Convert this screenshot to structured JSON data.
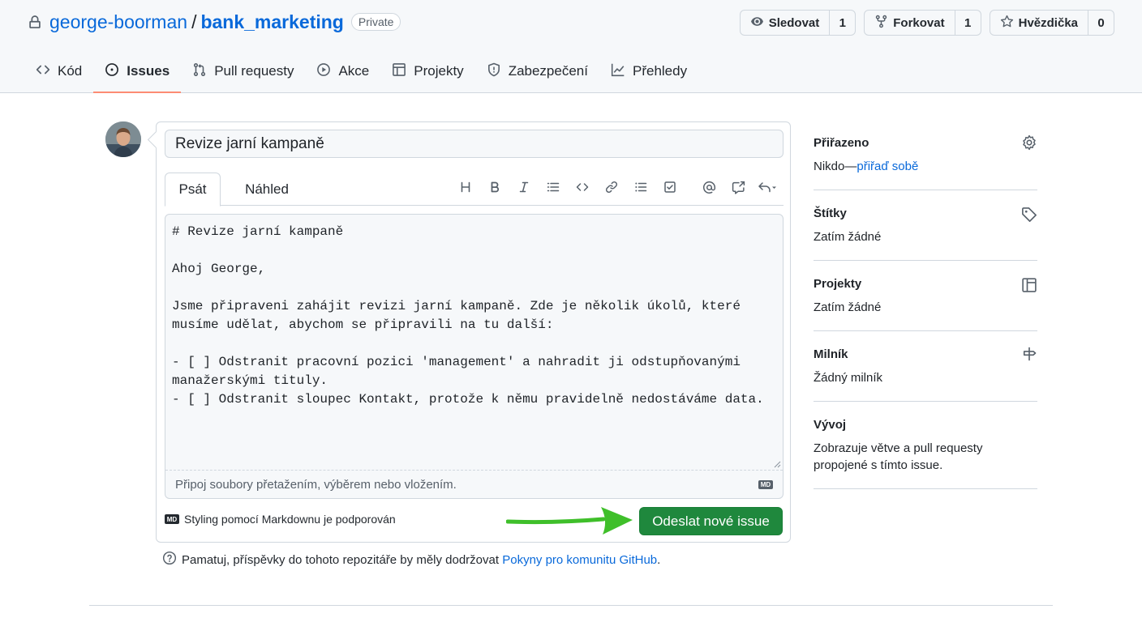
{
  "repo": {
    "owner": "george-boorman",
    "separator": "/",
    "name": "bank_marketing",
    "visibility": "Private"
  },
  "actions": [
    {
      "label": "Sledovat",
      "count": "1",
      "icon": "eye-icon"
    },
    {
      "label": "Forkovat",
      "count": "1",
      "icon": "fork-icon"
    },
    {
      "label": "Hvězdička",
      "count": "0",
      "icon": "star-icon"
    }
  ],
  "tabs": [
    {
      "label": "Kód",
      "icon": "code-icon",
      "active": false
    },
    {
      "label": "Issues",
      "icon": "issue-icon",
      "active": true
    },
    {
      "label": "Pull requesty",
      "icon": "pull-request-icon",
      "active": false
    },
    {
      "label": "Akce",
      "icon": "play-icon",
      "active": false
    },
    {
      "label": "Projekty",
      "icon": "table-icon",
      "active": false
    },
    {
      "label": "Zabezpečení",
      "icon": "shield-icon",
      "active": false
    },
    {
      "label": "Přehledy",
      "icon": "graph-icon",
      "active": false
    }
  ],
  "issue": {
    "title": "Revize jarní kampaně",
    "body": "# Revize jarní kampaně\n\nAhoj George,\n\nJsme připraveni zahájit revizi jarní kampaně. Zde je několik úkolů, které musíme udělat, abychom se připravili na tu další:\n\n- [ ] Odstranit pracovní pozici 'management' a nahradit ji odstupňovanými manažerskými tituly.\n- [ ] Odstranit sloupec Kontakt, protože k němu pravidelně nedostáváme data."
  },
  "editor": {
    "write_tab": "Psát",
    "preview_tab": "Náhled",
    "attach_hint": "Připoj soubory přetažením, výběrem nebo vložením.",
    "markdown_note": "Styling pomocí Markdownu je podporován",
    "md_badge": "MD",
    "submit_label": "Odeslat nové issue",
    "toolbar_icons": [
      "heading-icon",
      "bold-icon",
      "italic-icon",
      "quote-icon",
      "code-icon",
      "link-icon",
      "unordered-list-icon",
      "task-list-icon",
      "mention-icon",
      "cross-reference-icon",
      "reply-icon"
    ]
  },
  "guidelines": {
    "prefix": "Pamatuj, příspěvky do tohoto repozitáře by měly dodržovat",
    "link": "Pokyny pro komunitu GitHub",
    "suffix": "."
  },
  "sidebar": {
    "assignees": {
      "title": "Přiřazeno",
      "value_prefix": "Nikdo—",
      "value_link": "přiřaď sobě",
      "icon": "gear-icon"
    },
    "labels": {
      "title": "Štítky",
      "value": "Zatím žádné",
      "icon": "tag-icon"
    },
    "projects": {
      "title": "Projekty",
      "value": "Zatím žádné",
      "icon": "project-icon"
    },
    "milestone": {
      "title": "Milník",
      "value": "Žádný milník",
      "icon": "milestone-icon"
    },
    "development": {
      "title": "Vývoj",
      "value": "Zobrazuje větve a pull requesty propojené s tímto issue."
    }
  },
  "colors": {
    "link": "#0969da",
    "primary_button": "#1f883d",
    "active_tab_underline": "#fd8c73",
    "annotation_arrow": "#3fbf2a"
  }
}
